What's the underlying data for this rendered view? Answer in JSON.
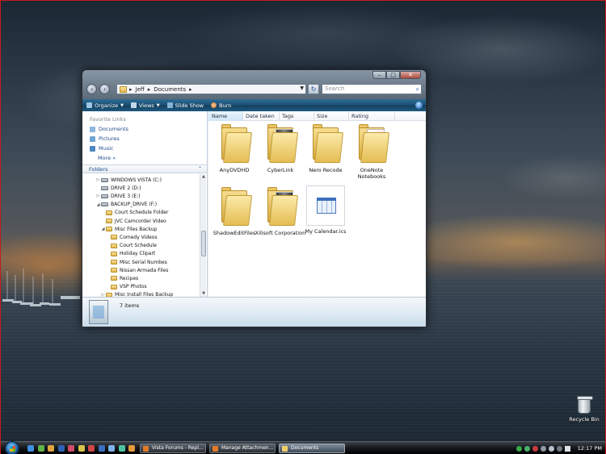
{
  "window": {
    "address": [
      "Jeff",
      "Documents"
    ],
    "search_placeholder": "Search",
    "toolbar": [
      {
        "label": "Organize",
        "icon": "organize-icon",
        "dropdown": true
      },
      {
        "label": "Views",
        "icon": "views-icon",
        "dropdown": true
      },
      {
        "label": "Slide Show",
        "icon": "slideshow-icon",
        "dropdown": false
      },
      {
        "label": "Burn",
        "icon": "burn-icon",
        "dropdown": false
      }
    ],
    "caption_buttons": {
      "minimize": "–",
      "maximize": "□",
      "close": "✕"
    }
  },
  "navpane": {
    "favorites_title": "Favorite Links",
    "favorites": [
      "Documents",
      "Pictures",
      "Music"
    ],
    "more_label": "More",
    "more_glyph": "»",
    "folders_label": "Folders",
    "tree": [
      {
        "label": "WINDOWS VISTA (C:)",
        "type": "drive",
        "level": 0,
        "expander": "▷"
      },
      {
        "label": "DRIVE 2 (D:)",
        "type": "drive",
        "level": 0,
        "expander": ""
      },
      {
        "label": "DRIVE 3 (E:)",
        "type": "drive",
        "level": 0,
        "expander": "▷"
      },
      {
        "label": "BACKUP_DRIVE (F:)",
        "type": "drive",
        "level": 0,
        "expander": "◢"
      },
      {
        "label": "Court Schedule Folder",
        "type": "folder",
        "level": 1,
        "expander": ""
      },
      {
        "label": "JVC Camcorder Video",
        "type": "folder",
        "level": 1,
        "expander": ""
      },
      {
        "label": "Misc Files Backup",
        "type": "folder",
        "level": 1,
        "expander": "◢"
      },
      {
        "label": "Comedy Videos",
        "type": "folder",
        "level": 2,
        "expander": ""
      },
      {
        "label": "Court Schedule",
        "type": "folder",
        "level": 2,
        "expander": ""
      },
      {
        "label": "Holiday Clipart",
        "type": "folder",
        "level": 2,
        "expander": ""
      },
      {
        "label": "Misc Serial Numbes",
        "type": "folder",
        "level": 2,
        "expander": ""
      },
      {
        "label": "Nissan Armada Files",
        "type": "folder",
        "level": 2,
        "expander": ""
      },
      {
        "label": "Recipes",
        "type": "folder",
        "level": 2,
        "expander": ""
      },
      {
        "label": "VSP Photos",
        "type": "folder",
        "level": 2,
        "expander": ""
      },
      {
        "label": "Misc Install Files Backup",
        "type": "folder",
        "level": 1,
        "expander": "▷"
      }
    ]
  },
  "content": {
    "columns": [
      "Name",
      "Date taken",
      "Tags",
      "Size",
      "Rating"
    ],
    "items": [
      {
        "label": "AnyDVDHD",
        "type": "folder",
        "paper": "none"
      },
      {
        "label": "CyberLink",
        "type": "folder",
        "paper": "dark"
      },
      {
        "label": "Nero Recode",
        "type": "folder",
        "paper": "none"
      },
      {
        "label": "OneNote Notebooks",
        "type": "folder",
        "paper": "pink"
      },
      {
        "label": "ShadowEditFiles",
        "type": "folder",
        "paper": "none"
      },
      {
        "label": "Xilisoft Corporation",
        "type": "folder",
        "paper": "dark"
      },
      {
        "label": "My Calendar.ics",
        "type": "ics",
        "paper": "none"
      }
    ]
  },
  "details": {
    "count_text": "7 items"
  },
  "desktop": {
    "recycle_label": "Recycle Bin"
  },
  "taskbar": {
    "buttons": [
      {
        "label": "Vista Forums - Repl...",
        "active": false,
        "icon": "browser-icon"
      },
      {
        "label": "Manage Attachmen...",
        "active": false,
        "icon": "browser-icon"
      },
      {
        "label": "Documents",
        "active": true,
        "icon": "folder-icon"
      }
    ],
    "clock": "12:17 PM",
    "colors": {
      "quicklaunch": [
        "#3d8fe0",
        "#5fb34a",
        "#e0a33d",
        "#2c62b3",
        "#d14a6a",
        "#d8c24a",
        "#cf4747",
        "#3b6ec2",
        "#7cb2e8",
        "#4ec2a0",
        "#e49a3a"
      ]
    }
  }
}
